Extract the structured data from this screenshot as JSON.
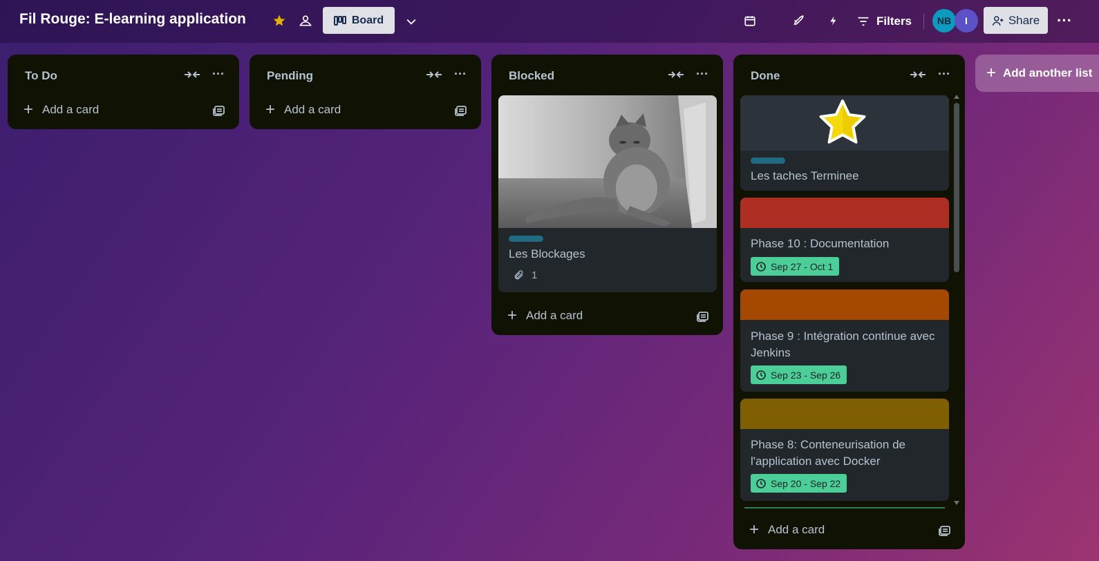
{
  "header": {
    "board_title": "Fil Rouge: E-learning application",
    "view_label": "Board",
    "filters_label": "Filters",
    "share_label": "Share",
    "members": [
      {
        "initials": "NB",
        "color": "#0c9bbf"
      },
      {
        "initials": "I",
        "color": "#5b52c7"
      }
    ],
    "starred": true,
    "accent_star_color": "#e2b203"
  },
  "lists": [
    {
      "title": "To Do",
      "add_card_label": "Add a card"
    },
    {
      "title": "Pending",
      "add_card_label": "Add a card"
    },
    {
      "title": "Blocked",
      "add_card_label": "Add a card"
    },
    {
      "title": "Done",
      "add_card_label": "Add a card"
    }
  ],
  "cards": {
    "blocked": [
      {
        "title": "Les Blockages",
        "label_color": "#206a83",
        "attachments": "1",
        "cover": "cat-photo"
      }
    ],
    "done": [
      {
        "title": "Les taches Terminee",
        "label_color": "#206a83",
        "cover": "star-icon"
      },
      {
        "title": "Phase 10 : Documentation",
        "cover_color": "#ae2e24",
        "dates": "Sep 27 - Oct 1"
      },
      {
        "title": "Phase 9 : Intégration continue avec Jenkins",
        "cover_color": "#a54800",
        "dates": "Sep 23 - Sep 26"
      },
      {
        "title": "Phase 8: Conteneurisation de l'application avec Docker",
        "cover_color": "#7f5f01",
        "dates": "Sep 20 - Sep 22"
      }
    ]
  },
  "add_list_label": "Add another list",
  "colors": {
    "list_bg": "#101204",
    "card_bg": "#22272b",
    "date_badge": "#4bce97"
  }
}
